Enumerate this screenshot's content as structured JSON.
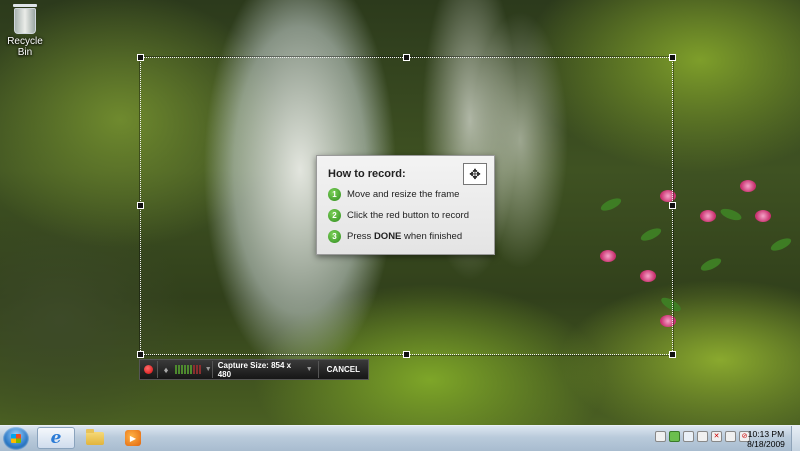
{
  "desktop": {
    "icons": [
      {
        "label": "Recycle Bin",
        "icon": "recycle-bin-icon"
      }
    ]
  },
  "howto": {
    "title": "How to record:",
    "move_icon": "move-arrows-icon",
    "steps": [
      {
        "num": "1",
        "text": "Move and resize the frame"
      },
      {
        "num": "2",
        "text": "Click the red button to record"
      },
      {
        "num": "3",
        "text_pre": "Press ",
        "text_bold": "DONE",
        "text_post": " when finished"
      }
    ]
  },
  "toolbar": {
    "record_icon": "record-icon",
    "mic_icon": "microphone-icon",
    "capture_size_label": "Capture Size: 854 x 480",
    "cancel_label": "CANCEL"
  },
  "taskbar": {
    "start_icon": "start-orb-icon",
    "pinned": [
      "internet-explorer-icon",
      "folder-icon",
      "media-player-icon"
    ],
    "clock_time": "10:13 PM",
    "clock_date": "8/18/2009"
  },
  "colors": {
    "accent_record": "#d10b0b",
    "step_badge": "#2f8b1e",
    "toolbar_bg": "#1e1e1e"
  }
}
